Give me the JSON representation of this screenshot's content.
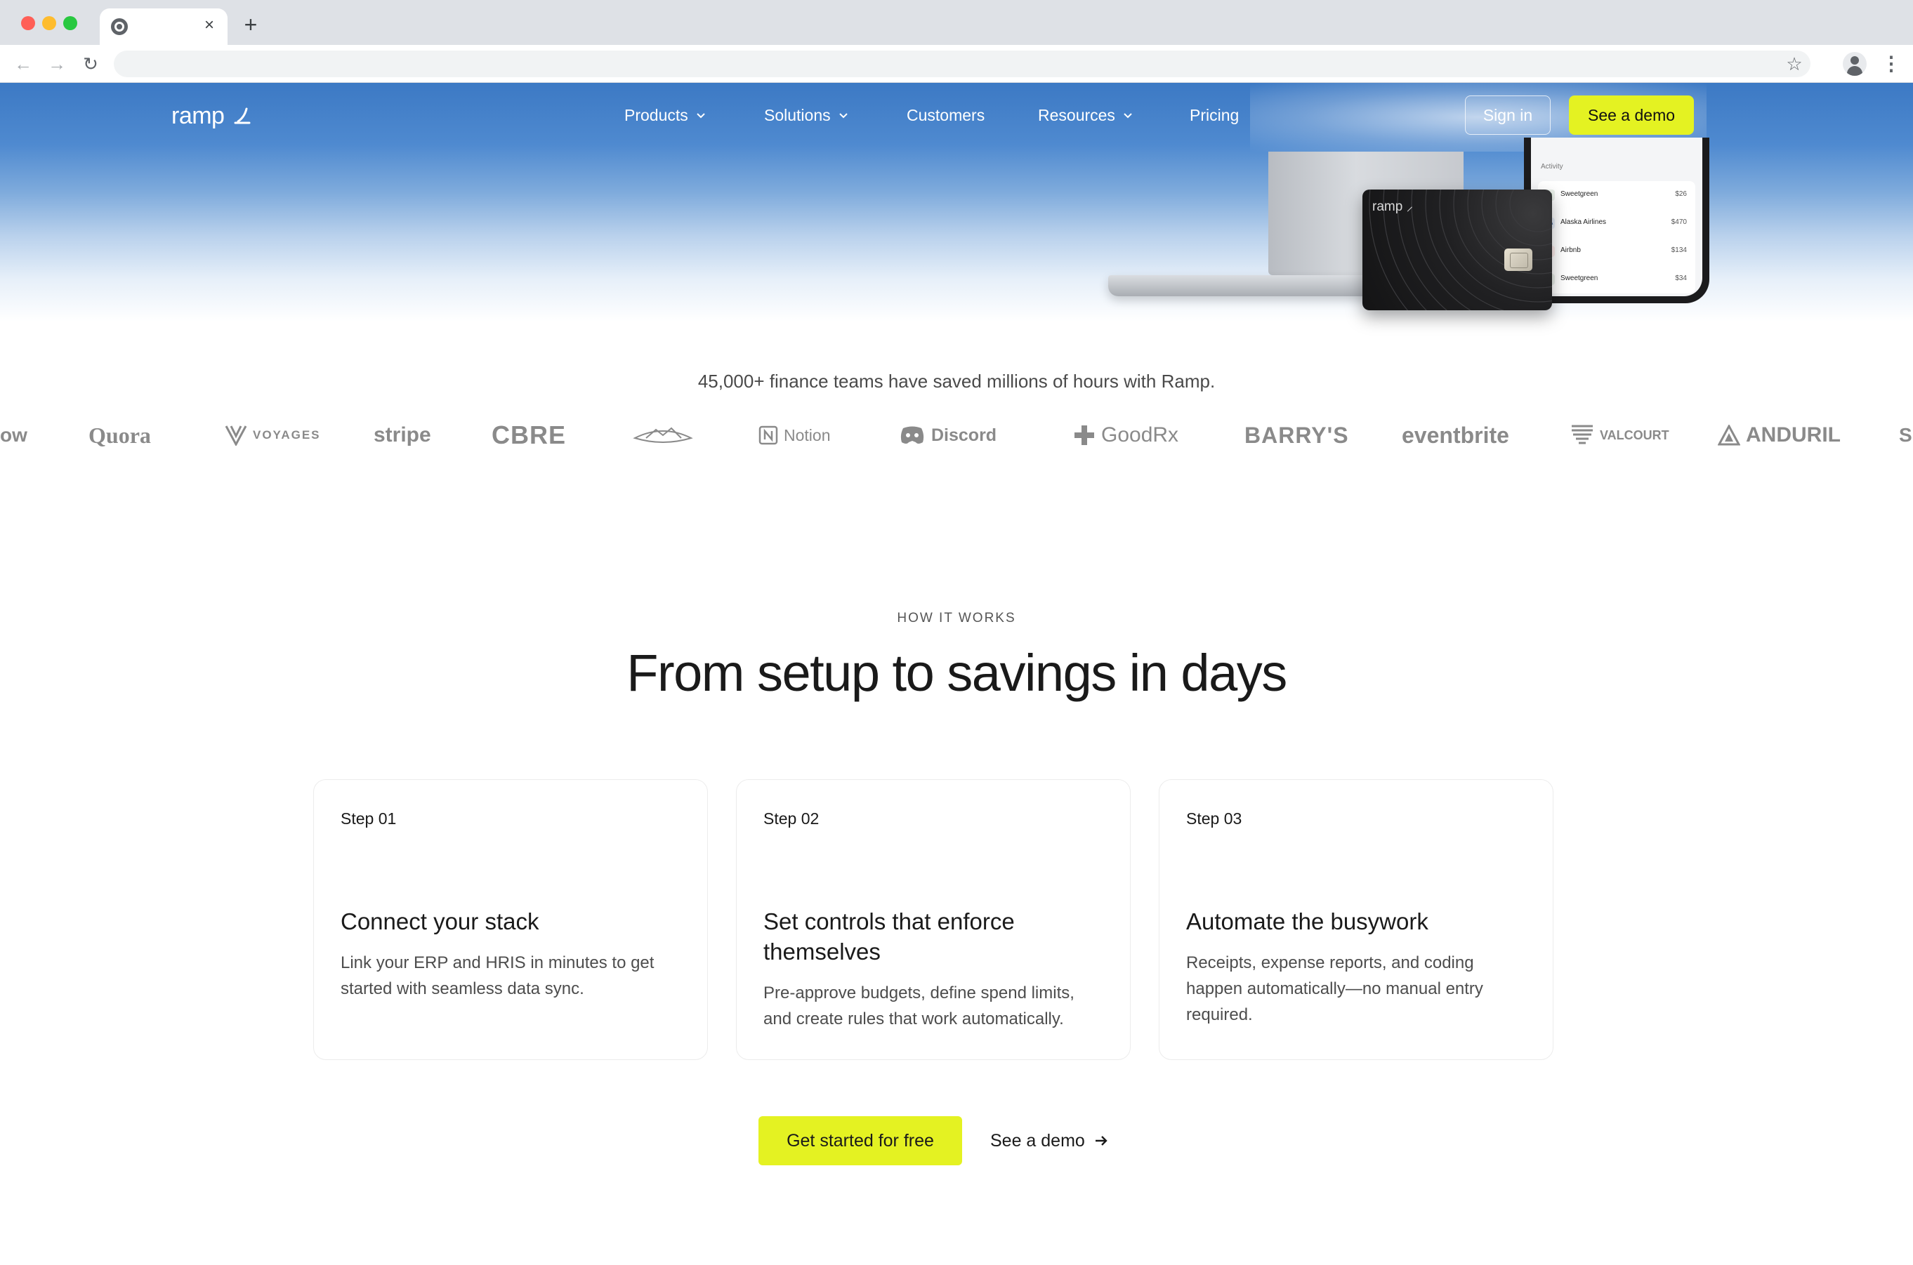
{
  "browser": {
    "tab_close": "×",
    "new_tab": "+",
    "back": "←",
    "forward": "→",
    "reload": "↻",
    "bookmark": "☆",
    "menu": "⋮"
  },
  "brand": {
    "name": "ramp",
    "accent": "#e4f222",
    "nav_blue": "#3c79c4"
  },
  "nav": {
    "items": [
      {
        "label": "Products",
        "dropdown": true
      },
      {
        "label": "Solutions",
        "dropdown": true
      },
      {
        "label": "Customers",
        "dropdown": false
      },
      {
        "label": "Resources",
        "dropdown": true
      },
      {
        "label": "Pricing",
        "dropdown": false
      }
    ],
    "sign_in": "Sign in",
    "demo": "See a demo"
  },
  "hero_visual": {
    "card_brand": "ramp",
    "activity_label": "Activity",
    "activity": [
      {
        "name": "Sweetgreen",
        "amount": "$26"
      },
      {
        "name": "Alaska Airlines",
        "amount": "$470"
      },
      {
        "name": "Airbnb",
        "amount": "$134"
      },
      {
        "name": "Sweetgreen",
        "amount": "$34"
      }
    ]
  },
  "trust": {
    "text": "45,000+ finance teams have saved millions of hours with Ramp.",
    "logos": [
      "ow",
      "Quora",
      "VOYAGES",
      "stripe",
      "CBRE",
      "Sierra Nevada",
      "Notion",
      "Discord",
      "GoodRx",
      "BARRY'S",
      "eventbrite",
      "VALCOURT",
      "ANDURIL",
      "S"
    ]
  },
  "how_it_works": {
    "eyebrow": "HOW IT WORKS",
    "headline": "From setup to savings in days",
    "steps": [
      {
        "number": "Step 01",
        "title": "Connect your stack",
        "description": "Link your ERP and HRIS in minutes to get started with seamless data sync."
      },
      {
        "number": "Step 02",
        "title": "Set controls that enforce themselves",
        "description": "Pre-approve budgets, define spend limits, and create rules that work automatically."
      },
      {
        "number": "Step 03",
        "title": "Automate the busywork",
        "description": "Receipts, expense reports, and coding happen automatically—no manual entry required."
      }
    ],
    "cta_primary": "Get started for free",
    "cta_secondary": "See a demo"
  }
}
